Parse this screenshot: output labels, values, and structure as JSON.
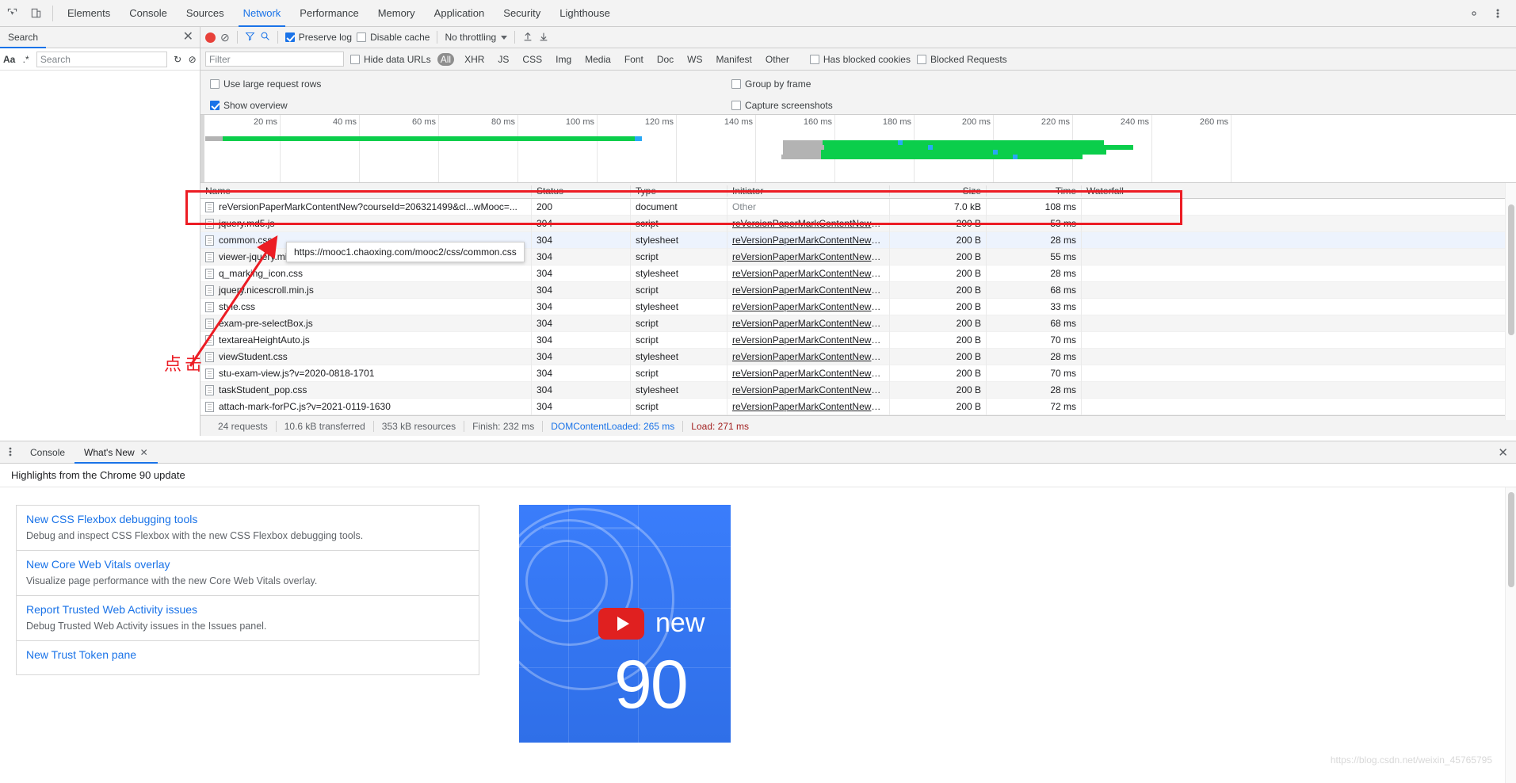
{
  "topbar": {
    "icons": [
      "inspect-icon",
      "device-toolbar-icon"
    ],
    "tabs": [
      {
        "label": "Elements",
        "active": false
      },
      {
        "label": "Console",
        "active": false
      },
      {
        "label": "Sources",
        "active": false
      },
      {
        "label": "Network",
        "active": true
      },
      {
        "label": "Performance",
        "active": false
      },
      {
        "label": "Memory",
        "active": false
      },
      {
        "label": "Application",
        "active": false
      },
      {
        "label": "Security",
        "active": false
      },
      {
        "label": "Lighthouse",
        "active": false
      }
    ],
    "right_icons": [
      "gear-icon",
      "kebab-menu-icon"
    ]
  },
  "search_pane": {
    "tab_label": "Search",
    "close_label": "✕",
    "match_case_label": "Aa",
    "regex_label": ".*",
    "input_value": "",
    "input_placeholder": "Search",
    "refresh_icon": "refresh-icon",
    "clear_icon": "clear-icon"
  },
  "network": {
    "toolbar": {
      "record_label": "record-button",
      "clear_label": "clear-button",
      "filter_icon": "filter-icon",
      "search_icon": "search-icon",
      "preserve_log_label": "Preserve log",
      "preserve_log_checked": true,
      "disable_cache_label": "Disable cache",
      "disable_cache_checked": false,
      "throttling_label": "No throttling",
      "import_icon": "import-har-icon",
      "export_icon": "export-har-icon"
    },
    "filterbar": {
      "filter_value": "",
      "filter_placeholder": "Filter",
      "hide_data_urls_label": "Hide data URLs",
      "hide_data_urls_checked": false,
      "types": [
        "All",
        "XHR",
        "JS",
        "CSS",
        "Img",
        "Media",
        "Font",
        "Doc",
        "WS",
        "Manifest",
        "Other"
      ],
      "active_type": "All",
      "has_blocked_cookies_label": "Has blocked cookies",
      "has_blocked_cookies_checked": false,
      "blocked_requests_label": "Blocked Requests",
      "blocked_requests_checked": false
    },
    "settings": {
      "use_large_rows_label": "Use large request rows",
      "use_large_rows_checked": false,
      "group_by_frame_label": "Group by frame",
      "group_by_frame_checked": false,
      "show_overview_label": "Show overview",
      "show_overview_checked": true,
      "capture_screenshots_label": "Capture screenshots",
      "capture_screenshots_checked": false
    },
    "overview_ticks": [
      "20 ms",
      "40 ms",
      "60 ms",
      "80 ms",
      "100 ms",
      "120 ms",
      "140 ms",
      "160 ms",
      "180 ms",
      "200 ms",
      "220 ms",
      "240 ms",
      "260 ms"
    ],
    "columns": [
      "Name",
      "Status",
      "Type",
      "Initiator",
      "Size",
      "Time",
      "Waterfall"
    ],
    "rows": [
      {
        "name": "reVersionPaperMarkContentNew?courseId=206321499&cl...wMooc=...",
        "status": "200",
        "type": "document",
        "initiator": "Other",
        "size": "7.0 kB",
        "time": "108 ms"
      },
      {
        "name": "jquery.md5.js",
        "status": "304",
        "type": "script",
        "initiator": "reVersionPaperMarkContentNew?...",
        "size": "200 B",
        "time": "53 ms"
      },
      {
        "name": "common.css",
        "status": "304",
        "type": "stylesheet",
        "initiator": "reVersionPaperMarkContentNew?...",
        "size": "200 B",
        "time": "28 ms"
      },
      {
        "name": "viewer-jquery.min.js",
        "status": "304",
        "type": "script",
        "initiator": "reVersionPaperMarkContentNew?...",
        "size": "200 B",
        "time": "55 ms"
      },
      {
        "name": "q_marking_icon.css",
        "status": "304",
        "type": "stylesheet",
        "initiator": "reVersionPaperMarkContentNew?...",
        "size": "200 B",
        "time": "28 ms"
      },
      {
        "name": "jquery.nicescroll.min.js",
        "status": "304",
        "type": "script",
        "initiator": "reVersionPaperMarkContentNew?...",
        "size": "200 B",
        "time": "68 ms"
      },
      {
        "name": "style.css",
        "status": "304",
        "type": "stylesheet",
        "initiator": "reVersionPaperMarkContentNew?...",
        "size": "200 B",
        "time": "33 ms"
      },
      {
        "name": "exam-pre-selectBox.js",
        "status": "304",
        "type": "script",
        "initiator": "reVersionPaperMarkContentNew?...",
        "size": "200 B",
        "time": "68 ms"
      },
      {
        "name": "textareaHeightAuto.js",
        "status": "304",
        "type": "script",
        "initiator": "reVersionPaperMarkContentNew?...",
        "size": "200 B",
        "time": "70 ms"
      },
      {
        "name": "viewStudent.css",
        "status": "304",
        "type": "stylesheet",
        "initiator": "reVersionPaperMarkContentNew?...",
        "size": "200 B",
        "time": "28 ms"
      },
      {
        "name": "stu-exam-view.js?v=2020-0818-1701",
        "status": "304",
        "type": "script",
        "initiator": "reVersionPaperMarkContentNew?...",
        "size": "200 B",
        "time": "70 ms"
      },
      {
        "name": "taskStudent_pop.css",
        "status": "304",
        "type": "stylesheet",
        "initiator": "reVersionPaperMarkContentNew?...",
        "size": "200 B",
        "time": "28 ms"
      },
      {
        "name": "attach-mark-forPC.js?v=2021-0119-1630",
        "status": "304",
        "type": "script",
        "initiator": "reVersionPaperMarkContentNew?...",
        "size": "200 B",
        "time": "72 ms"
      }
    ],
    "tooltip": "https://mooc1.chaoxing.com/mooc2/css/common.css",
    "status": {
      "requests": "24 requests",
      "transferred": "10.6 kB transferred",
      "resources": "353 kB resources",
      "finish": "Finish: 232 ms",
      "dom_content_loaded": "DOMContentLoaded: 265 ms",
      "load": "Load: 271 ms"
    }
  },
  "annotation": {
    "text": "点击",
    "color": "#ec1c24"
  },
  "drawer": {
    "menu_icon": "kebab-menu-icon",
    "tabs": [
      {
        "label": "Console",
        "active": false,
        "closable": false
      },
      {
        "label": "What's New",
        "active": true,
        "closable": true
      }
    ],
    "close_label": "✕",
    "heading": "Highlights from the Chrome 90 update",
    "cards": [
      {
        "title": "New CSS Flexbox debugging tools",
        "desc": "Debug and inspect CSS Flexbox with the new CSS Flexbox debugging tools."
      },
      {
        "title": "New Core Web Vitals overlay",
        "desc": "Visualize page performance with the new Core Web Vitals overlay."
      },
      {
        "title": "Report Trusted Web Activity issues",
        "desc": "Debug Trusted Web Activity issues in the Issues panel."
      },
      {
        "title": "New Trust Token pane",
        "desc": ""
      }
    ],
    "media": {
      "new_text": "new",
      "version_text": "90",
      "play_icon": "play-button-icon"
    }
  },
  "watermark": "https://blog.csdn.net/weixin_45765795"
}
